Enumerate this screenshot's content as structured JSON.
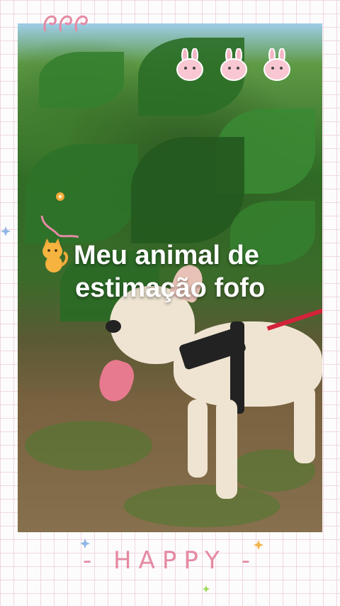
{
  "post": {
    "title_line1": "Meu animal de",
    "title_line2": "estimação fofo",
    "title_icon": "cat-emoji"
  },
  "footer": {
    "label": "- HAPPY -"
  },
  "decorations": {
    "bunnies": [
      "bunny-face-icon",
      "bunny-face-icon",
      "bunny-face-icon"
    ],
    "stars": [
      "star-blue",
      "star-orange",
      "star-green"
    ],
    "accent_color": "#e58aa3"
  }
}
